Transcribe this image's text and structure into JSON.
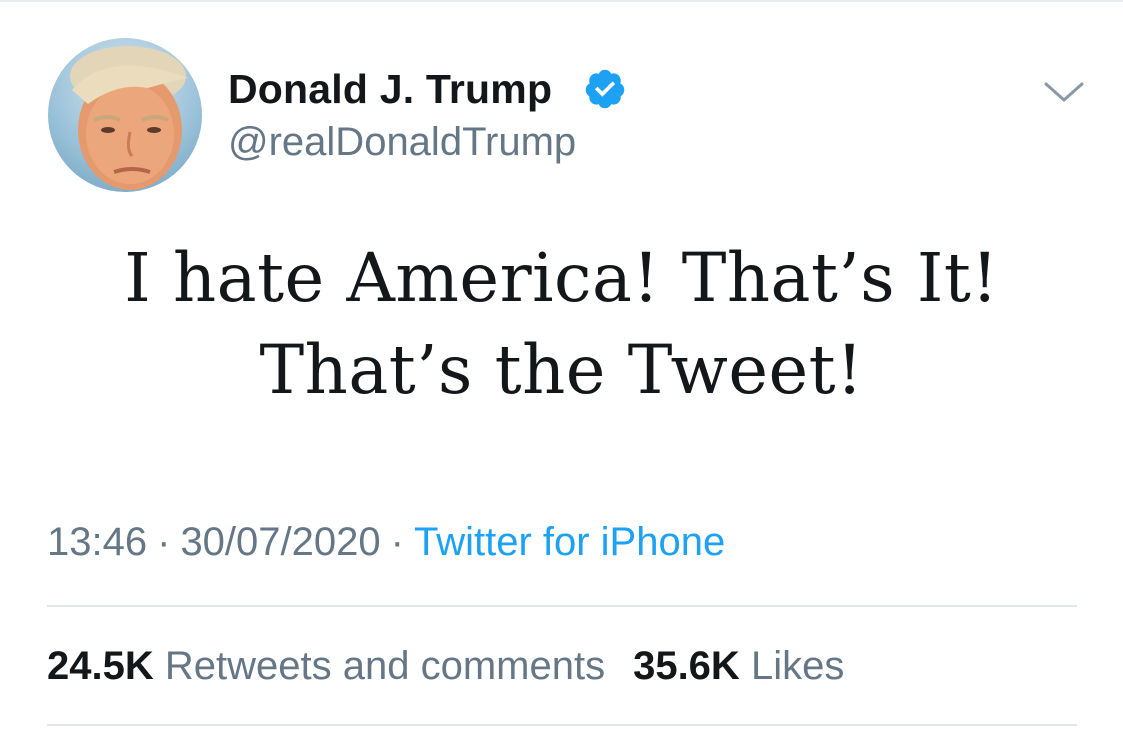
{
  "tweet": {
    "author": {
      "display_name": "Donald J. Trump",
      "handle": "@realDonaldTrump",
      "verified": true,
      "avatar_icon": "profile-photo"
    },
    "text_lines": [
      "I hate America! That’s It!",
      "That’s the Tweet!"
    ],
    "time": "13:46",
    "date": "30/07/2020",
    "separator": "·",
    "source": "Twitter for iPhone",
    "stats": {
      "retweets_count": "24.5K",
      "retweets_label": "Retweets and comments",
      "likes_count": "35.6K",
      "likes_label": "Likes"
    }
  },
  "colors": {
    "text": "#14171a",
    "secondary": "#657786",
    "accent": "#1da1f2",
    "divider": "#e1e8ed"
  },
  "icons": {
    "verified": "verified-badge-icon",
    "menu": "chevron-down-icon"
  }
}
